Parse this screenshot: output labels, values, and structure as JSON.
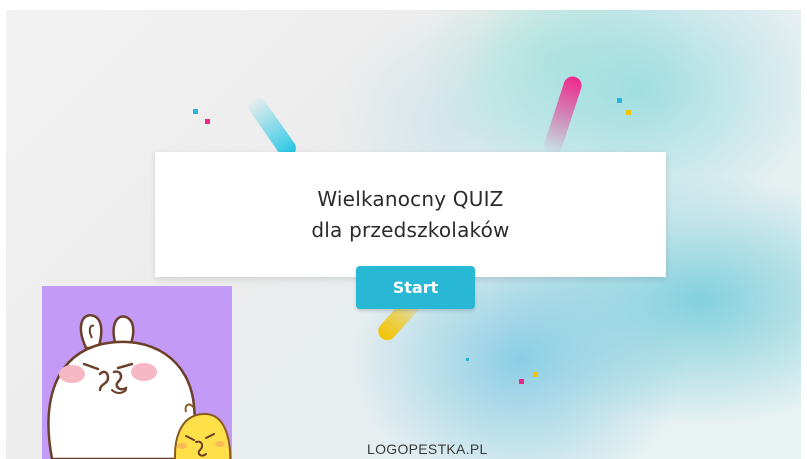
{
  "slide": {
    "title_line1": "Wielkanocny QUIZ",
    "title_line2": "dla przedszkolaków",
    "start_label": "Start",
    "footer_text": "LOGOPESTKA.PL"
  },
  "colors": {
    "accent": "#29b7d6",
    "thumbnail_bg": "#c39bf7",
    "streak_cyan": "#1cc4e0",
    "streak_pink": "#f0288c",
    "streak_yellow": "#f5c400"
  },
  "icons": [
    "bunny-illustration",
    "chick-illustration"
  ]
}
